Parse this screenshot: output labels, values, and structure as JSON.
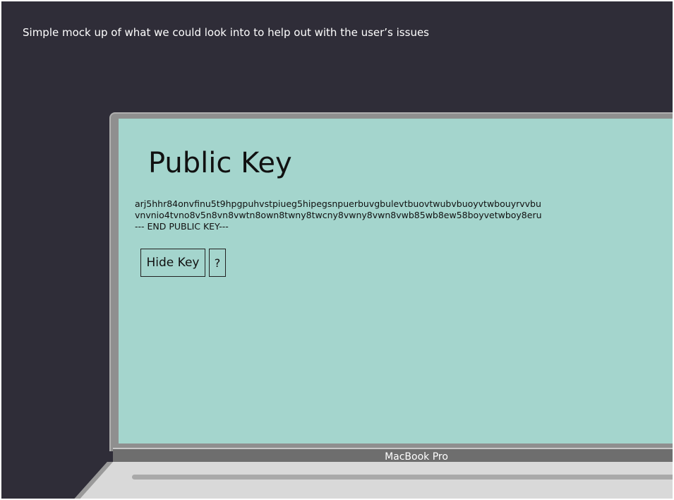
{
  "caption": "Simple mock up of what we could look into to help out with the user’s issues",
  "screen": {
    "title": "Public Key",
    "key_lines": [
      "arj5hhr84onvfinu5t9hpgpuhvstpiueg5hipegsnpuerbuvgbulevtbuovtwubvbuoyvtwbouyrvvbu",
      "vnvnio4tvno8v5n8vn8vwtn8own8twny8twcny8vwny8vwn8vwb85wb8ew58boyvetwboy8eru",
      "--- END PUBLIC KEY---"
    ],
    "hide_key_label": "Hide Key",
    "help_label": "?"
  },
  "device": {
    "model_label": "MacBook Pro"
  },
  "colors": {
    "background": "#2f2d38",
    "screen": "#a4d5cd",
    "bezel": "#8f8f8f"
  }
}
